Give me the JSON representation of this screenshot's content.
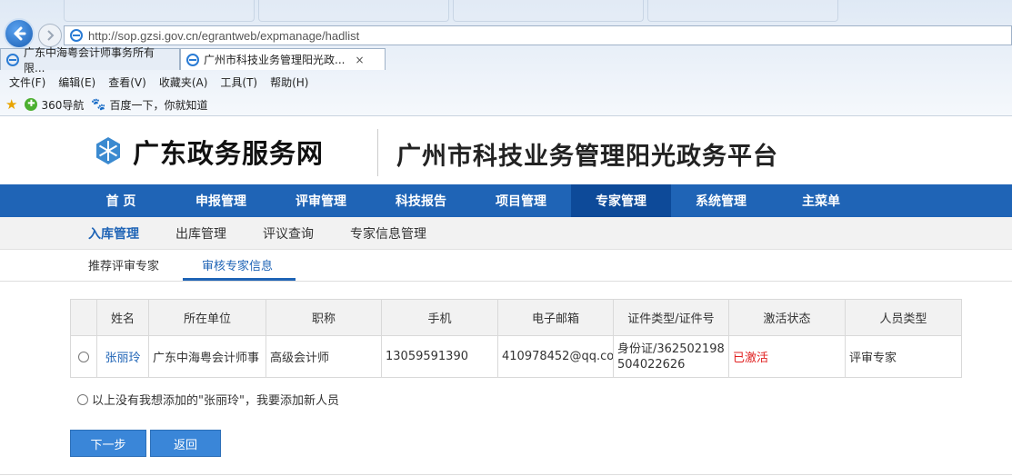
{
  "browser": {
    "address_url": "http://sop.gzsi.gov.cn/egrantweb/expmanage/hadlist",
    "tabs": [
      {
        "title": "广东中海粤会计师事务所有限..."
      },
      {
        "title": "广州市科技业务管理阳光政...",
        "close": "×"
      }
    ],
    "menu": [
      "文件(F)",
      "编辑(E)",
      "查看(V)",
      "收藏夹(A)",
      "工具(T)",
      "帮助(H)"
    ],
    "favorites": [
      "360导航",
      "百度一下，你就知道"
    ]
  },
  "site": {
    "title": "广东政务服务网",
    "platform": "广州市科技业务管理阳光政务平台",
    "accent_color": "#1f64b6"
  },
  "main_nav": [
    "首 页",
    "申报管理",
    "评审管理",
    "科技报告",
    "项目管理",
    "专家管理",
    "系统管理",
    "主菜单"
  ],
  "main_nav_active": "专家管理",
  "sub_nav": [
    "入库管理",
    "出库管理",
    "评议查询",
    "专家信息管理"
  ],
  "sub_nav_active": "入库管理",
  "tabs": [
    "推荐评审专家",
    "审核专家信息"
  ],
  "tabs_active": "审核专家信息",
  "table": {
    "columns": [
      "",
      "姓名",
      "所在单位",
      "职称",
      "手机",
      "电子邮箱",
      "证件类型/证件号",
      "激活状态",
      "人员类型"
    ],
    "rows": [
      {
        "name": "张丽玲",
        "unit": "广东中海粤会计师事",
        "title": "高级会计师",
        "phone": "13059591390",
        "email": "410978452@qq.co",
        "id": "身份证/362502198504022626",
        "status": "已激活",
        "type": "评审专家"
      }
    ]
  },
  "add_new_label": "以上没有我想添加的\"张丽玲\"，我要添加新人员",
  "buttons": {
    "next": "下一步",
    "back": "返回"
  }
}
